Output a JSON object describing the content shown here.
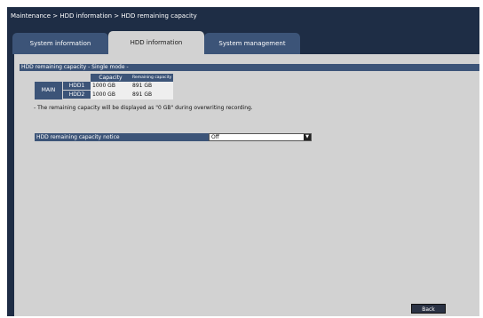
{
  "breadcrumb": "Maintenance > HDD information > HDD remaining capacity",
  "tabs": [
    {
      "label": "System information"
    },
    {
      "label": "HDD information"
    },
    {
      "label": "System management"
    }
  ],
  "section": {
    "title": "HDD remaining capacity - Single mode -"
  },
  "table": {
    "headers": [
      "Capacity",
      "Remaining capacity"
    ],
    "group": "MAIN",
    "rows": [
      {
        "hdd": "HDD1",
        "capacity": "1000 GB",
        "remaining": "891 GB"
      },
      {
        "hdd": "HDD2",
        "capacity": "1000 GB",
        "remaining": "891 GB"
      }
    ]
  },
  "note": "- The remaining capacity will be displayed as \"0 GB\" during overwriting recording.",
  "notice": {
    "label": "HDD remaining capacity notice",
    "value": "Off"
  },
  "back_label": "Back",
  "colors": {
    "frame": "#1e2d45",
    "tab": "#3c5478",
    "content": "#d2d2d2"
  }
}
